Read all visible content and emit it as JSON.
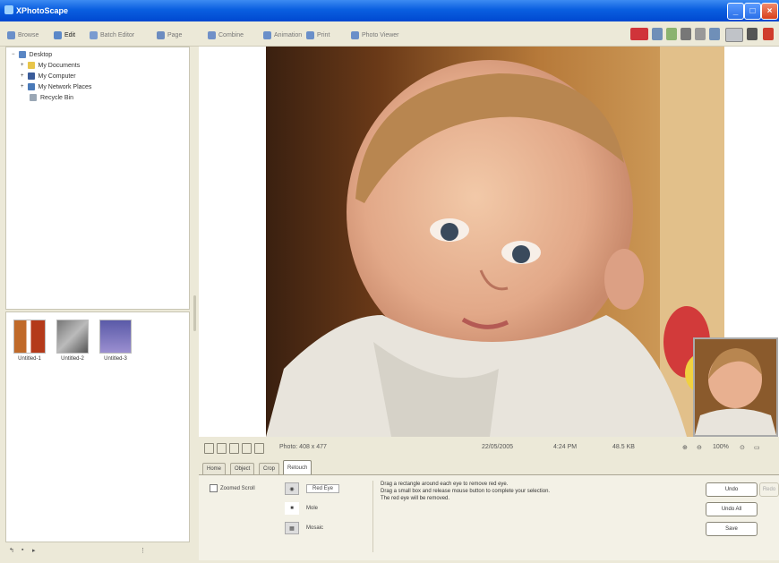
{
  "window": {
    "title": "XPhotoScape"
  },
  "toolbar": {
    "items": [
      "Browse",
      "Edit",
      "Batch Editor",
      "Page",
      "Combine",
      "Animation",
      "Print",
      "Photo Viewer"
    ]
  },
  "tree": {
    "items": [
      "Desktop",
      "My Documents",
      "My Computer",
      "My Network Places",
      "Recycle Bin"
    ]
  },
  "thumbnails": [
    {
      "caption": "Untitled-1"
    },
    {
      "caption": "Untitled-2"
    },
    {
      "caption": "Untitled-3"
    }
  ],
  "status": {
    "dimensions": "Photo: 408 x 477",
    "date": "22/05/2005",
    "time": "4:24 PM",
    "filesize": "48.5 KB",
    "zoom": "100%"
  },
  "tabs": [
    "Home",
    "Object",
    "Crop",
    "Retouch"
  ],
  "retouch": {
    "zoom_option": "Zoomed Scroll",
    "tools": [
      "Red Eye",
      "Mole",
      "Mosaic"
    ],
    "instructions": [
      "Drag a rectangle around each eye to remove red eye.",
      "Drag a small box and release mouse button to complete your selection.",
      "The red eye will be removed."
    ],
    "buttons": {
      "undo": "Undo",
      "redo": "Redo",
      "undo_all": "Undo All",
      "save": "Save"
    }
  },
  "colors": {
    "titlebar": "#0a5fe0",
    "toolbar_bg": "#ece9d8",
    "panel_bg": "#f3f1e6"
  }
}
